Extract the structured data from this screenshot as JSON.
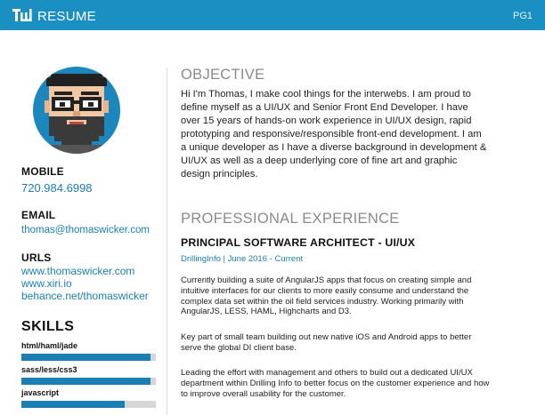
{
  "header": {
    "logo_icon": "tw-logo-icon",
    "title": "RESUME",
    "page": "PG1",
    "bar_color": "#1a8fc1"
  },
  "sidebar": {
    "avatar_icon": "pixel-avatar-icon",
    "mobile": {
      "heading": "MOBILE",
      "value": "720.984.6998"
    },
    "email": {
      "heading": "EMAIL",
      "value": "thomas@thomaswicker.com"
    },
    "urls": {
      "heading": "URLS",
      "items": [
        "www.thomaswicker.com",
        "www.xiri.io",
        "behance.net/thomaswicker"
      ]
    },
    "skills": {
      "heading": "SKILLS",
      "items": [
        {
          "label": "html/haml/jade",
          "level": 0.96
        },
        {
          "label": "sass/less/css3",
          "level": 0.96
        },
        {
          "label": "javascript",
          "level": 0.77
        }
      ]
    },
    "accent_color": "#1b7fb3"
  },
  "main": {
    "objective": {
      "title": "OBJECTIVE",
      "lines": [
        "Hi I'm Thomas, I make cool things for the interwebs. I am proud to",
        "define myself as a UI/UX and Senior Front End Developer. I have",
        "over 15 years of hands-on work experience in UI/UX design, rapid",
        "prototyping and responsive/responsible front-end development. I am",
        "a unique developer as I have a diverse background in development &",
        "UI/UX as well as a deep underlying core of fine art and graphic",
        "design principles."
      ]
    },
    "experience": {
      "title": "PROFESSIONAL EXPERIENCE",
      "job_title": "PRINCIPAL SOFTWARE ARCHITECT - UI/UX",
      "job_meta": "DrillingInfo | June 2016 - Current",
      "paragraphs": [
        [
          "Currently building a suite of AngularJS apps that focus on creating simple and",
          "intuitive interfaces for our clients to more easily consume and understand the",
          "complex data set within the oil field services industry. Working primarily with",
          "AngularJS, LESS, HAML, Highcharts and D3."
        ],
        [
          "Key part of small team building out new native iOS and Android apps to better",
          "serve the global DI client base."
        ],
        [
          "Leading the effort with management and others to build out a dedicated UI/UX",
          "department within Drilling Info to better focus on the customer experience and how",
          "to improve overall usability for the customer."
        ]
      ]
    }
  }
}
